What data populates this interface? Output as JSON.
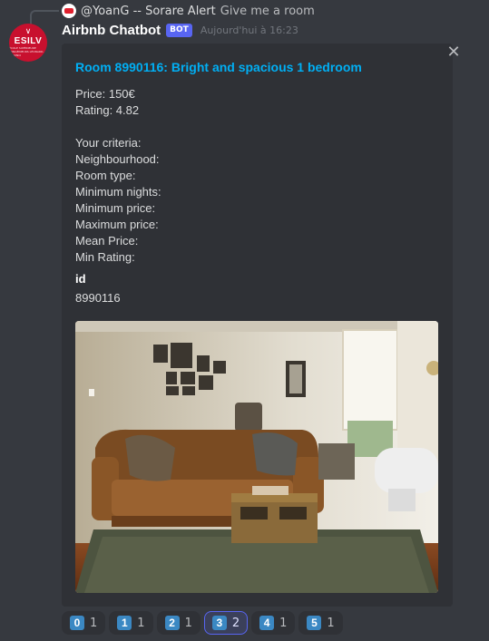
{
  "reply": {
    "author": "@YoanG -- Sorare Alert",
    "text": "Give me a room"
  },
  "message": {
    "avatar_text": "ESILV",
    "avatar_subtext": "ÉCOLE SUPÉRIEURE D'INGÉNIEURS LÉONARD-DE-VINCI",
    "username": "Airbnb Chatbot",
    "bot_tag": "BOT",
    "timestamp": "Aujourd'hui à 16:23"
  },
  "embed": {
    "title": "Room 8990116: Bright and spacious 1 bedroom",
    "description_lines": [
      "Price: 150€",
      "Rating: 4.82",
      "",
      "Your criteria:",
      "Neighbourhood:",
      "Room type:",
      "Minimum nights:",
      "Minimum price:",
      "Maximum price:",
      "Mean Price:",
      "Min Rating:"
    ],
    "field": {
      "name": "id",
      "value": "8990116"
    },
    "image_alt": "Living room with brown couch, coffee table and framed photos"
  },
  "reactions": [
    {
      "emoji": "0",
      "count": "1",
      "active": false
    },
    {
      "emoji": "1",
      "count": "1",
      "active": false
    },
    {
      "emoji": "2",
      "count": "1",
      "active": false
    },
    {
      "emoji": "3",
      "count": "2",
      "active": true
    },
    {
      "emoji": "4",
      "count": "1",
      "active": false
    },
    {
      "emoji": "5",
      "count": "1",
      "active": false
    }
  ],
  "icons": {
    "close": "close-icon"
  },
  "colors": {
    "background": "#36393f",
    "embed_bg": "#2f3136",
    "title_link": "#00aff4",
    "bot_tag": "#5865f2",
    "keycap": "#3b88c3"
  }
}
